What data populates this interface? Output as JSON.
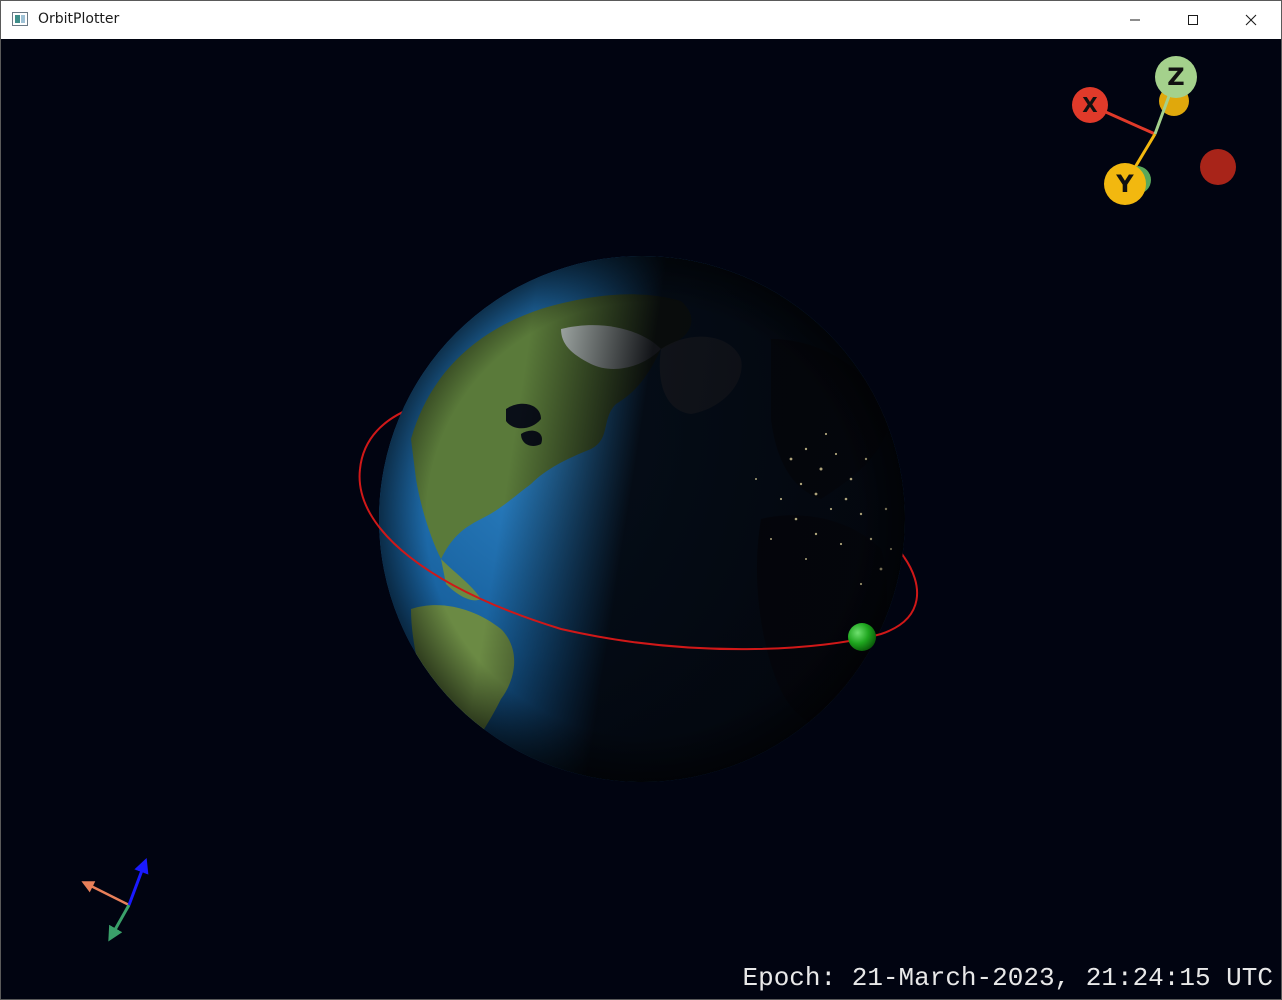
{
  "window": {
    "title": "OrbitPlotter",
    "controls": {
      "minimize": "minimize-icon",
      "maximize": "maximize-icon",
      "close": "close-icon"
    }
  },
  "gizmo": {
    "x_label": "X",
    "y_label": "Y",
    "z_label": "Z"
  },
  "status": {
    "epoch": "Epoch: 21-March-2023, 21:24:15 UTC"
  },
  "colors": {
    "background": "#010411",
    "orbit": "#d01818",
    "satellite": "#1ea51e",
    "x_axis": "#e03a2a",
    "y_axis": "#f2b80f",
    "z_axis": "#a4d18c"
  }
}
